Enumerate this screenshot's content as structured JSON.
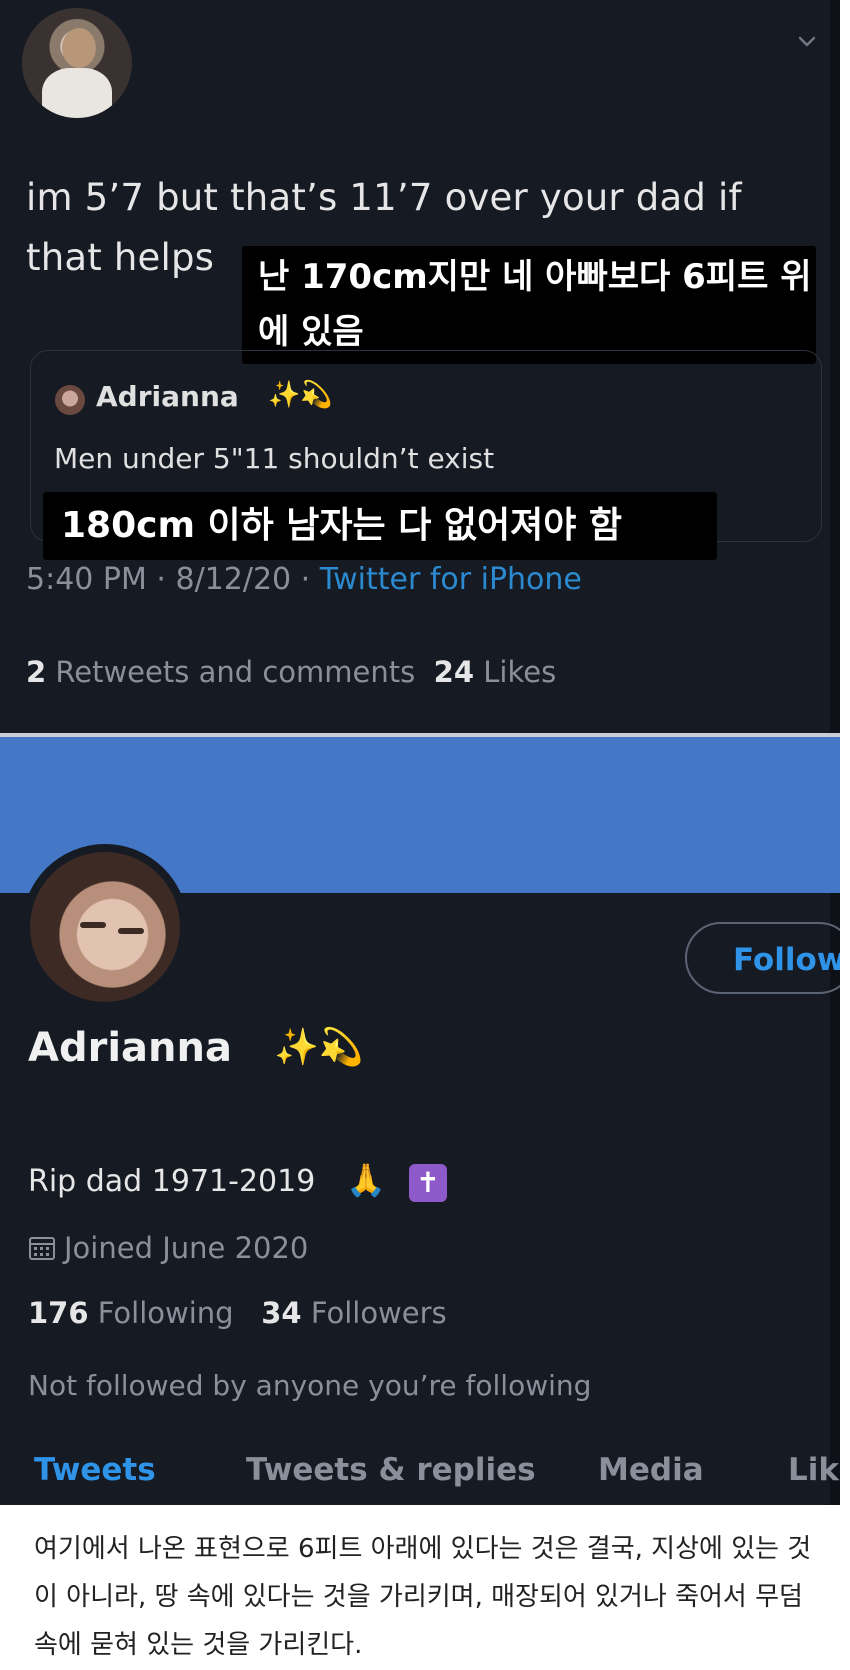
{
  "tweet": {
    "text_line1": "im 5’7 but that’s 11’7 over your dad if",
    "text_line2": "that helps",
    "caption": "난 170cm지만 네 아빠보다 6피트 위에 있음",
    "quote": {
      "name": "Adrianna",
      "emoji": "✨💫",
      "text": "Men under 5\"11 shouldn’t exist"
    },
    "quote_caption": "180cm 이하 남자는 다 없어져야 함",
    "time": "5:40 PM · 8/12/20 · ",
    "source": "Twitter for iPhone",
    "retweets_count": "2",
    "retweets_label": "Retweets and comments",
    "likes_count": "24",
    "likes_label": "Likes"
  },
  "profile": {
    "follow_label": "Follow",
    "name": "Adrianna",
    "name_emoji": "✨💫",
    "bio": "Rip dad 1971-2019",
    "bio_emoji": "🙏",
    "bio_cross": "✝",
    "joined": "Joined June 2020",
    "following_count": "176",
    "following_label": "Following",
    "followers_count": "34",
    "followers_label": "Followers",
    "not_followed": "Not followed by anyone you’re following",
    "tabs": [
      "Tweets",
      "Tweets & replies",
      "Media",
      "Lik"
    ]
  },
  "commentary": "여기에서 나온 표현으로 6피트 아래에 있다는 것은 결국, 지상에 있는 것이 아니라, 땅 속에 있다는 것을 가리키며, 매장되어 있거나 죽어서 무덤 속에 묻혀 있는 것을 가리킨다.",
  "colors": {
    "background": "#151a23",
    "accent": "#2f93e8",
    "banner": "#4477c6",
    "muted": "#8a909a"
  }
}
